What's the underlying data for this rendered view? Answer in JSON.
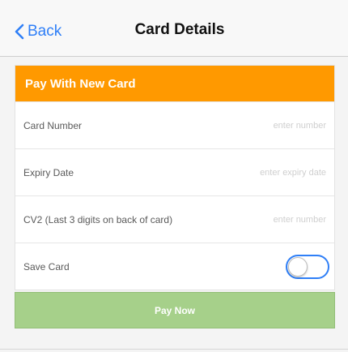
{
  "navbar": {
    "back_label": "Back",
    "title": "Card Details"
  },
  "card": {
    "header": "Pay With New Card",
    "fields": [
      {
        "label": "Card Number",
        "placeholder": "enter number",
        "value": ""
      },
      {
        "label": "Expiry Date",
        "placeholder": "enter expiry date",
        "value": ""
      },
      {
        "label": "CV2 (Last 3 digits on back of card)",
        "placeholder": "enter number",
        "value": ""
      }
    ],
    "save_label": "Save Card",
    "save_enabled": false
  },
  "pay_button": "Pay Now",
  "colors": {
    "accent": "#2f7ff7",
    "header": "#ff9900",
    "pay_button": "#a6d08a"
  },
  "icons": {
    "back": "chevron-left-icon"
  }
}
